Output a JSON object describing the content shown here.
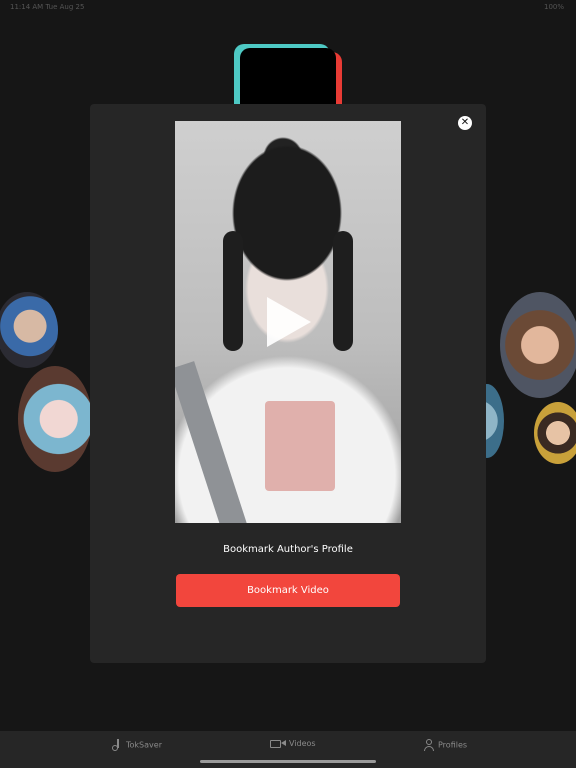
{
  "status_bar": {
    "time": "11:14 AM  Tue Aug 25",
    "battery": "100%"
  },
  "modal": {
    "close_icon": "close-icon",
    "video_play_icon": "play-icon",
    "author_link": "Bookmark Author's Profile",
    "bookmark_button": "Bookmark Video",
    "accent_color": "#f2463d"
  },
  "tabbar": {
    "tabs": [
      {
        "label": "TokSaver",
        "icon": "music-note-icon"
      },
      {
        "label": "Videos",
        "icon": "video-camera-icon"
      },
      {
        "label": "Profiles",
        "icon": "person-icon"
      }
    ]
  }
}
